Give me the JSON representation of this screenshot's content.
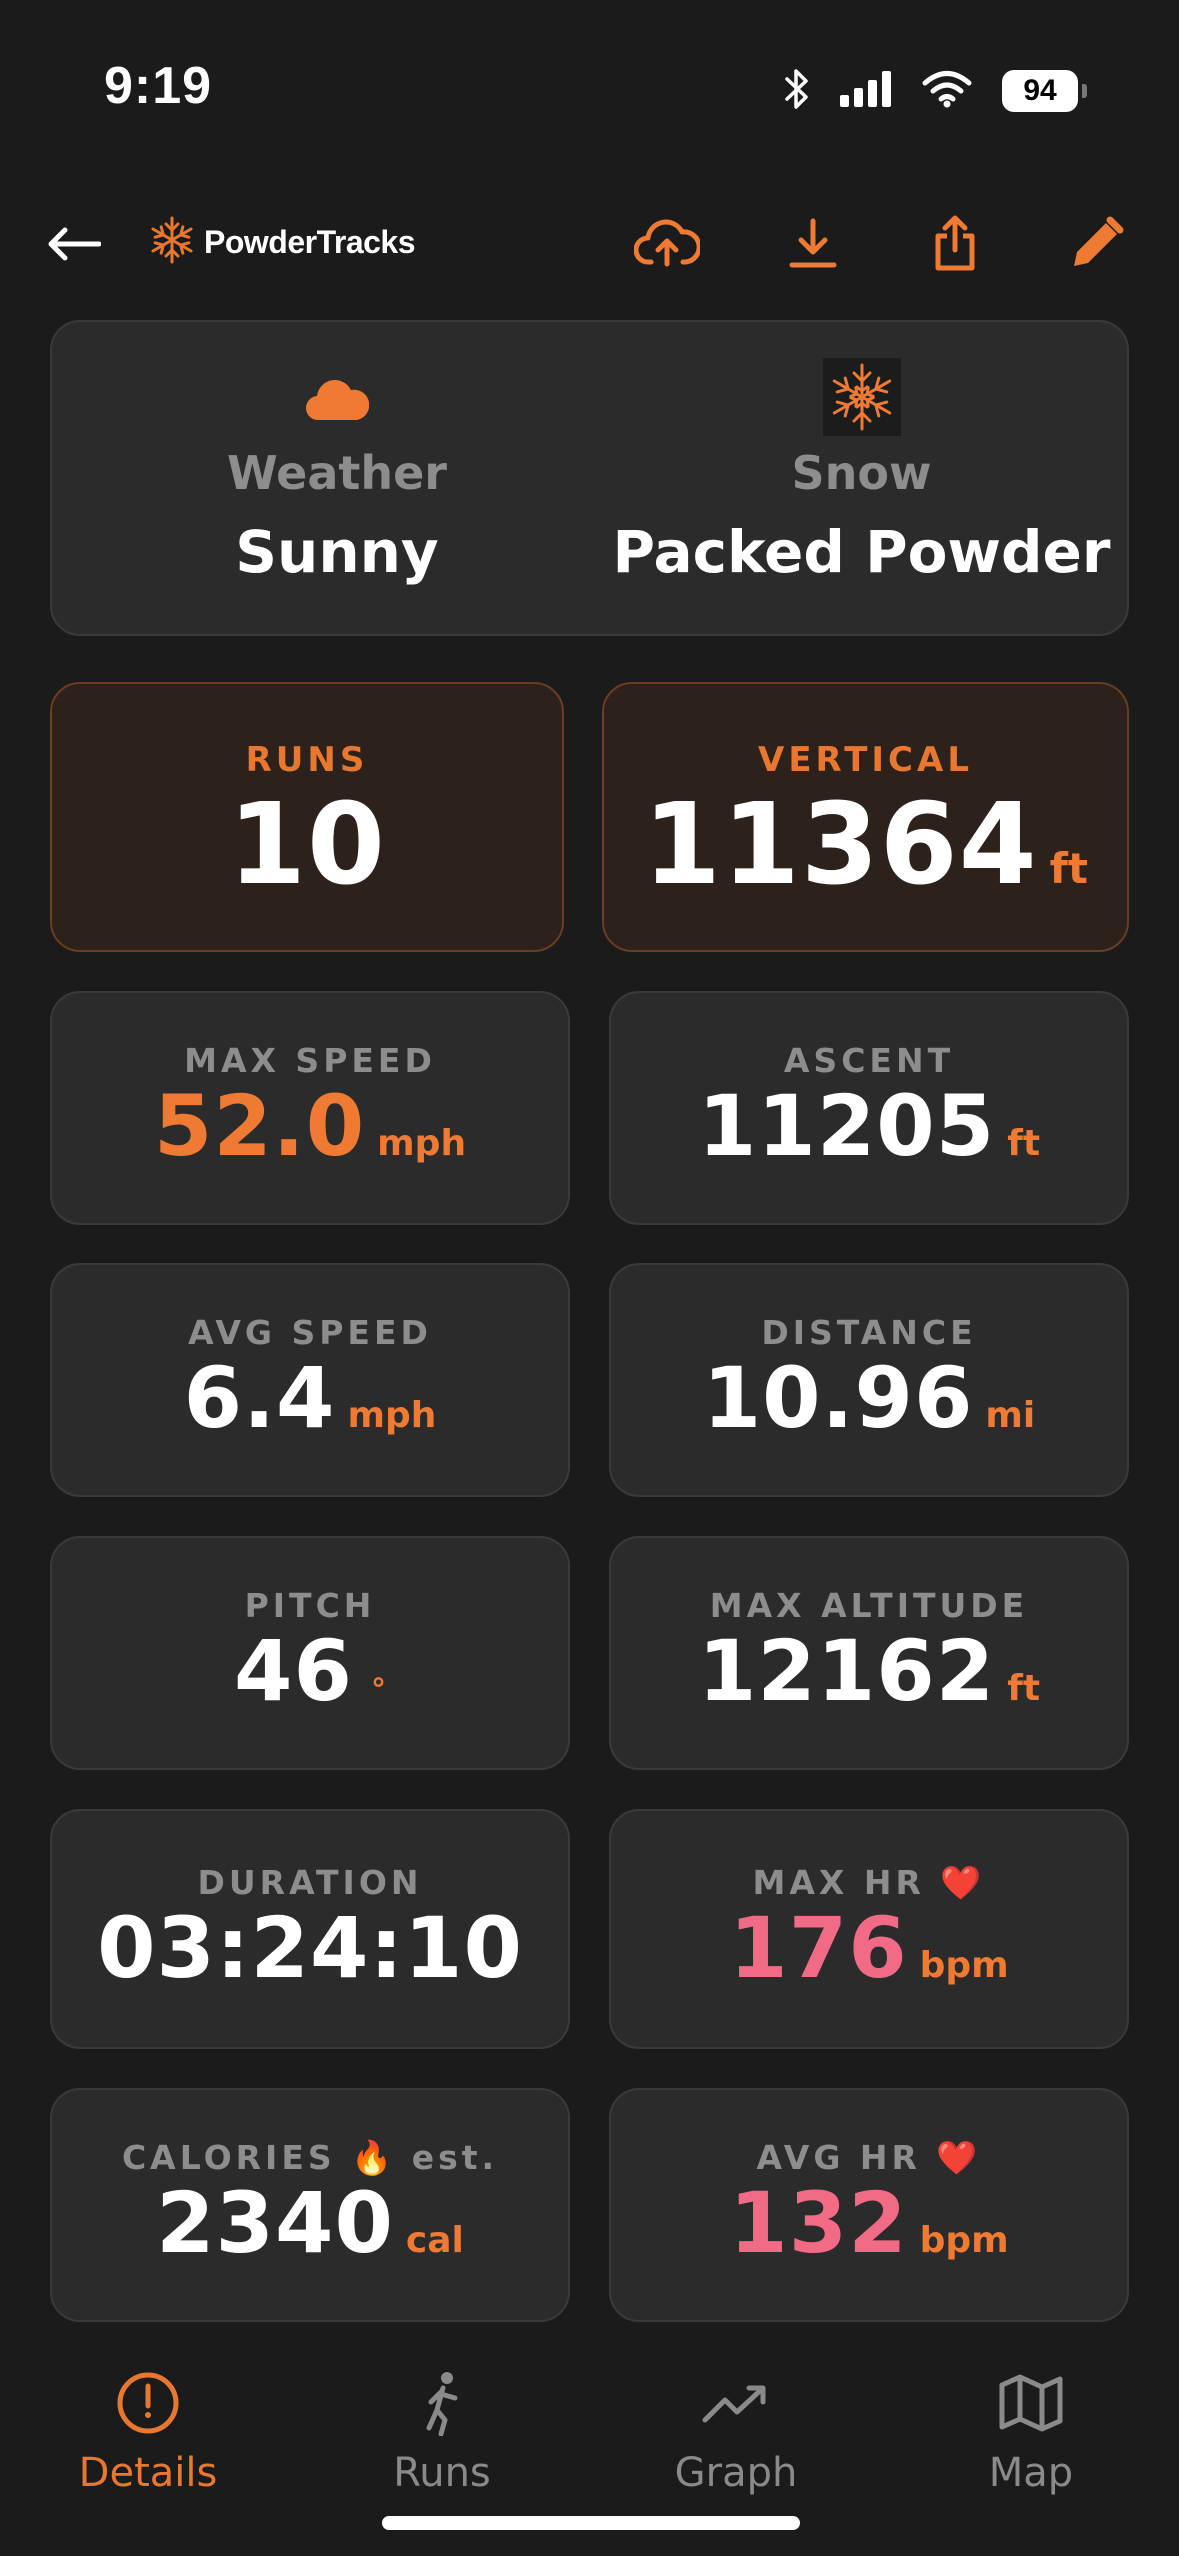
{
  "status_bar": {
    "time": "9:19",
    "battery": "94"
  },
  "header": {
    "app_name": "PowderTracks",
    "icons": [
      "back-arrow-icon",
      "snowflake-logo-icon",
      "cloud-upload-icon",
      "download-icon",
      "share-icon",
      "edit-pencil-icon"
    ]
  },
  "conditions": {
    "weather_label": "Weather",
    "weather_value": "Sunny",
    "snow_label": "Snow",
    "snow_value": "Packed Powder"
  },
  "stats": {
    "runs": {
      "label": "RUNS",
      "value": "10"
    },
    "vertical": {
      "label": "VERTICAL",
      "value": "11364",
      "unit": "ft"
    },
    "max_speed": {
      "label": "MAX SPEED",
      "value": "52.0",
      "unit": "mph"
    },
    "ascent": {
      "label": "ASCENT",
      "value": "11205",
      "unit": "ft"
    },
    "avg_speed": {
      "label": "AVG SPEED",
      "value": "6.4",
      "unit": "mph"
    },
    "distance": {
      "label": "DISTANCE",
      "value": "10.96",
      "unit": "mi"
    },
    "pitch": {
      "label": "PITCH",
      "value": "46",
      "unit": "°"
    },
    "max_altitude": {
      "label": "MAX ALTITUDE",
      "value": "12162",
      "unit": "ft"
    },
    "duration": {
      "label": "DURATION",
      "value": "03:24:10"
    },
    "max_hr": {
      "label": "MAX HR ❤️",
      "value": "176",
      "unit": "bpm"
    },
    "calories": {
      "label": "CALORIES 🔥 est.",
      "value": "2340",
      "unit": "cal"
    },
    "avg_hr": {
      "label": "AVG HR ❤️",
      "value": "132",
      "unit": "bpm"
    }
  },
  "tabs": {
    "details": "Details",
    "runs": "Runs",
    "graph": "Graph",
    "map": "Map",
    "active": "details"
  },
  "colors": {
    "accent": "#ee7a33",
    "heart_rate": "#f26b86",
    "background": "#1b1b1b",
    "card": "#2b2b2b"
  }
}
